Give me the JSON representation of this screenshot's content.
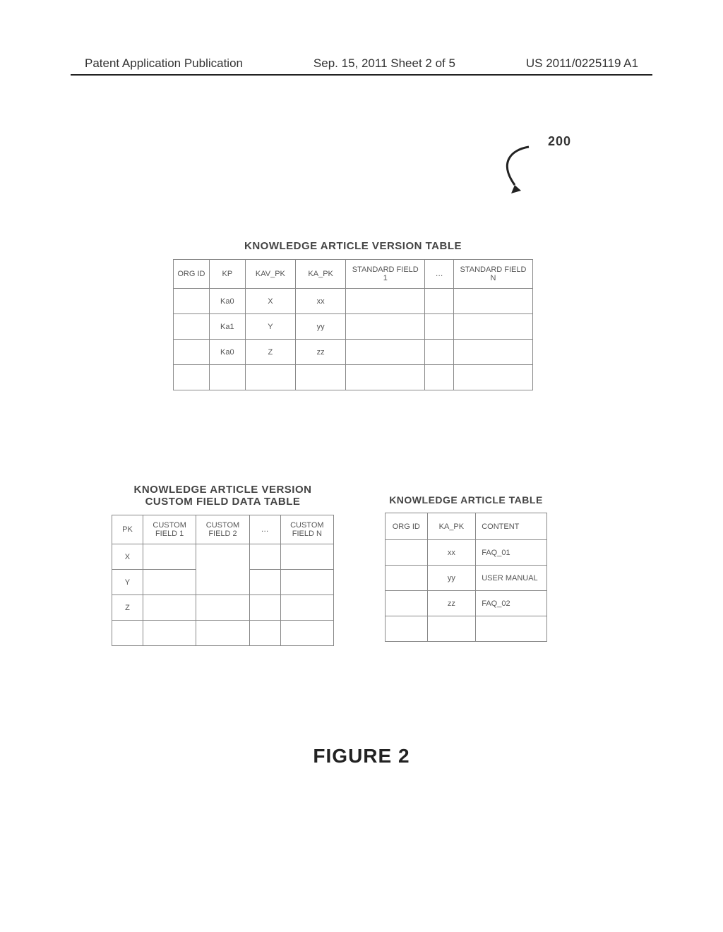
{
  "header": {
    "left": "Patent Application Publication",
    "center": "Sep. 15, 2011  Sheet 2 of 5",
    "right": "US 2011/0225119 A1"
  },
  "ref": "200",
  "tables": {
    "kav": {
      "title": "KNOWLEDGE ARTICLE VERSION TABLE",
      "headers": [
        "ORG ID",
        "KP",
        "KAV_PK",
        "KA_PK",
        "STANDARD FIELD 1",
        "…",
        "STANDARD FIELD N"
      ],
      "rows": [
        [
          "",
          "Ka0",
          "X",
          "xx",
          "",
          "",
          ""
        ],
        [
          "",
          "Ka1",
          "Y",
          "yy",
          "",
          "",
          ""
        ],
        [
          "",
          "Ka0",
          "Z",
          "zz",
          "",
          "",
          ""
        ],
        [
          "",
          "",
          "",
          "",
          "",
          "",
          ""
        ]
      ]
    },
    "cfd": {
      "title": "KNOWLEDGE ARTICLE VERSION CUSTOM FIELD DATA TABLE",
      "headers": [
        "PK",
        "CUSTOM FIELD 1",
        "CUSTOM FIELD 2",
        "…",
        "CUSTOM FIELD N"
      ],
      "rows": [
        [
          "X",
          "",
          "",
          "",
          ""
        ],
        [
          "Y",
          "",
          "",
          "",
          ""
        ],
        [
          "Z",
          "",
          "",
          "",
          ""
        ],
        [
          "",
          "",
          "",
          "",
          ""
        ]
      ]
    },
    "ka": {
      "title": "KNOWLEDGE ARTICLE TABLE",
      "headers": [
        "ORG ID",
        "KA_PK",
        "CONTENT"
      ],
      "rows": [
        [
          "",
          "xx",
          "FAQ_01"
        ],
        [
          "",
          "yy",
          "USER MANUAL"
        ],
        [
          "",
          "zz",
          "FAQ_02"
        ],
        [
          "",
          "",
          ""
        ]
      ]
    }
  },
  "figure": "FIGURE 2"
}
